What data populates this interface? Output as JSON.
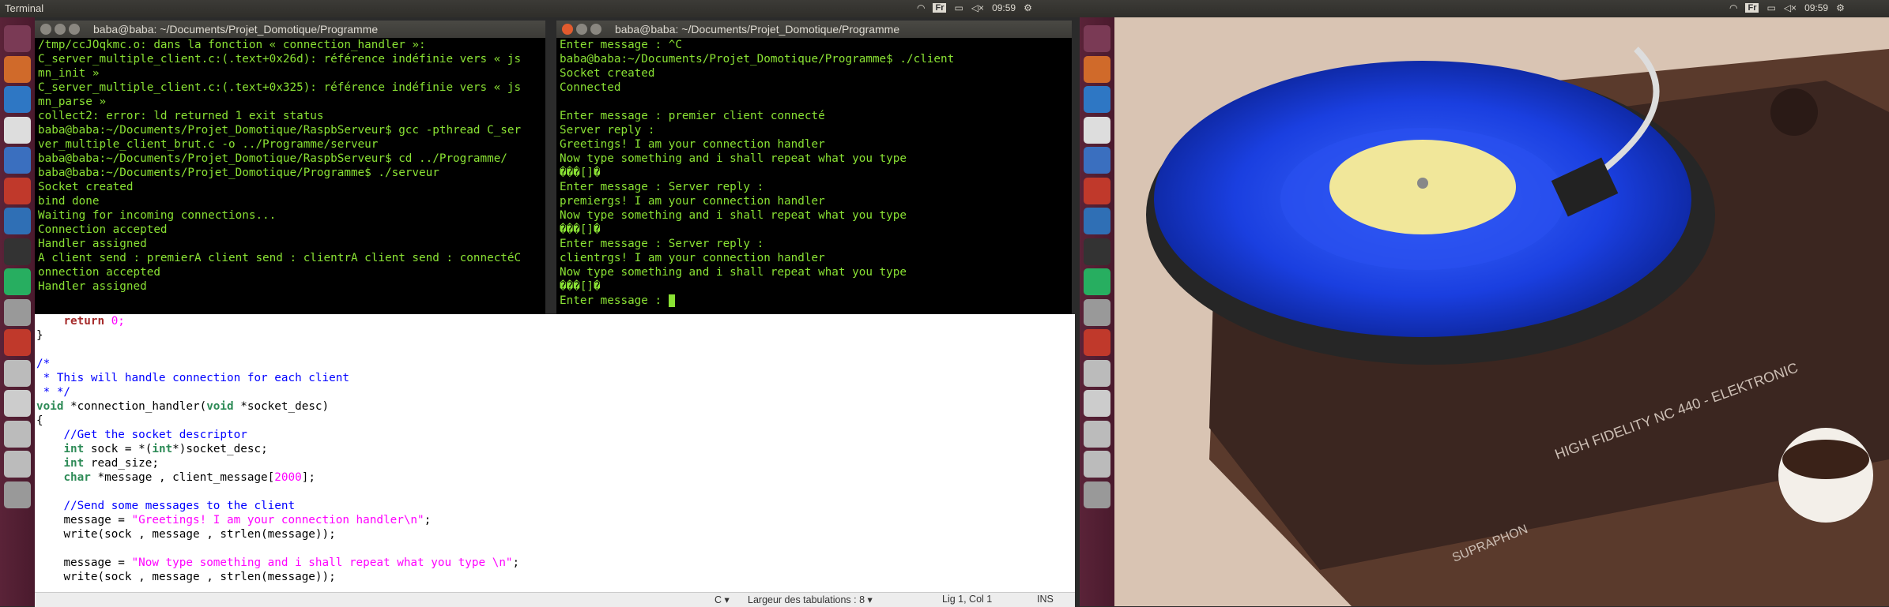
{
  "topbar": {
    "app_title": "Terminal",
    "time_left": "09:59",
    "time_right": "09:59",
    "keyboard_left": "Fr",
    "keyboard_right": "Fr"
  },
  "term_left": {
    "title": "baba@baba: ~/Documents/Projet_Domotique/Programme",
    "lines": [
      "/tmp/ccJOqkmc.o: dans la fonction « connection_handler »:",
      "C_server_multiple_client.c:(.text+0x26d): référence indéfinie vers « js",
      "mn_init »",
      "C_server_multiple_client.c:(.text+0x325): référence indéfinie vers « js",
      "mn_parse »",
      "collect2: error: ld returned 1 exit status",
      "baba@baba:~/Documents/Projet_Domotique/RaspbServeur$ gcc -pthread C_ser",
      "ver_multiple_client_brut.c -o ../Programme/serveur",
      "baba@baba:~/Documents/Projet_Domotique/RaspbServeur$ cd ../Programme/",
      "baba@baba:~/Documents/Projet_Domotique/Programme$ ./serveur",
      "Socket created",
      "bind done",
      "Waiting for incoming connections...",
      "Connection accepted",
      "Handler assigned",
      "A client send : premierA client send : clientrA client send : connectéC",
      "onnection accepted",
      "Handler assigned"
    ]
  },
  "term_right": {
    "title": "baba@baba: ~/Documents/Projet_Domotique/Programme",
    "lines": [
      "Enter message : ^C",
      "baba@baba:~/Documents/Projet_Domotique/Programme$ ./client",
      "Socket created",
      "Connected",
      "",
      "Enter message : premier client connecté",
      "Server reply :",
      "Greetings! I am your connection handler",
      "Now type something and i shall repeat what you type",
      "���[]�",
      "Enter message : Server reply :",
      "premiergs! I am your connection handler",
      "Now type something and i shall repeat what you type",
      "���[]�",
      "Enter message : Server reply :",
      "clientrgs! I am your connection handler",
      "Now type something and i shall repeat what you type",
      "���[]�",
      "Enter message : "
    ]
  },
  "editor": {
    "t0": "return",
    "t1": "0;",
    "t2": "}",
    "t3": "/*",
    "t4": " * This will handle connection for each client",
    "t5": " * */",
    "t6": "void",
    "t7": " *connection_handler(",
    "t8": "void",
    "t9": " *socket_desc)",
    "t10": "{",
    "t11": "//Get the socket descriptor",
    "t12": "int",
    "t13": " sock = *(",
    "t14": "int",
    "t15": "*)socket_desc;",
    "t16": "int",
    "t17": " read_size;",
    "t18": "char",
    "t19": " *message , client_message[",
    "t20": "2000",
    "t21": "];",
    "t22": "//Send some messages to the client",
    "t23": "message = ",
    "t24": "\"Greetings! I am your connection handler\\n\"",
    "t25": ";",
    "t26": "write(sock , message , strlen(message));",
    "t27": "message = ",
    "t28": "\"Now type something and i shall repeat what you type \\n\"",
    "t29": ";",
    "t30": "write(sock , message , strlen(message));"
  },
  "statusbar": {
    "language": "C",
    "tab_width": "Largeur des tabulations : 8",
    "position": "Lig 1, Col 1",
    "mode": "INS"
  },
  "wallpaper": {
    "label1": "HIGH FIDELITY NC 440 - ELEKTRONIC",
    "label2": "SUPRAPHON"
  },
  "launcher": {
    "items": [
      "dash-icon",
      "files-icon",
      "browser-icon",
      "texmaker-icon",
      "writer-icon",
      "settings-icon",
      "ubuntu-one-icon",
      "terminal-icon",
      "android-icon",
      "text-editor-icon",
      "image-viewer-icon",
      "drive-icon",
      "drive-icon",
      "drive-icon",
      "drive-icon",
      "trash-icon"
    ]
  }
}
